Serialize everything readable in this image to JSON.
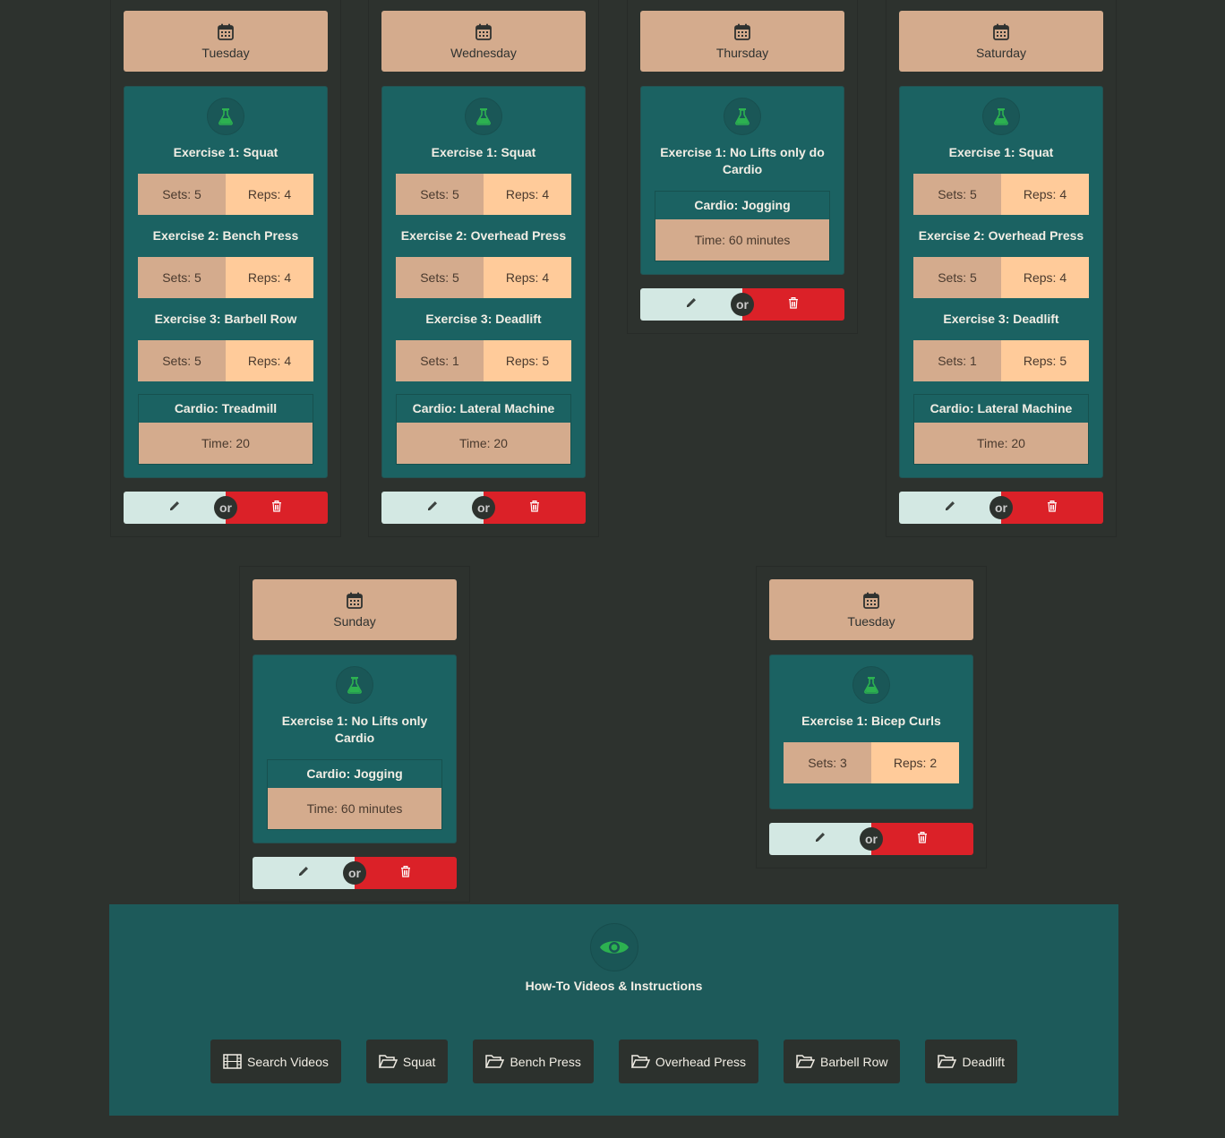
{
  "days": [
    {
      "day": "Tuesday",
      "exercises": [
        {
          "title": "Exercise 1: Squat",
          "sets": "Sets: 5",
          "reps": "Reps: 4"
        },
        {
          "title": "Exercise 2: Bench Press",
          "sets": "Sets: 5",
          "reps": "Reps: 4"
        },
        {
          "title": "Exercise 3: Barbell Row",
          "sets": "Sets: 5",
          "reps": "Reps: 4"
        }
      ],
      "cardio": {
        "title": "Cardio: Treadmill",
        "time": "Time: 20"
      }
    },
    {
      "day": "Wednesday",
      "exercises": [
        {
          "title": "Exercise 1: Squat",
          "sets": "Sets: 5",
          "reps": "Reps: 4"
        },
        {
          "title": "Exercise 2: Overhead Press",
          "sets": "Sets: 5",
          "reps": "Reps: 4"
        },
        {
          "title": "Exercise 3: Deadlift",
          "sets": "Sets: 1",
          "reps": "Reps: 5"
        }
      ],
      "cardio": {
        "title": "Cardio: Lateral Machine",
        "time": "Time: 20"
      }
    },
    {
      "day": "Thursday",
      "exercises": [
        {
          "title": "Exercise 1: No Lifts only do Cardio"
        }
      ],
      "cardio": {
        "title": "Cardio: Jogging",
        "time": "Time: 60 minutes"
      }
    },
    {
      "day": "Saturday",
      "exercises": [
        {
          "title": "Exercise 1: Squat",
          "sets": "Sets: 5",
          "reps": "Reps: 4"
        },
        {
          "title": "Exercise 2: Overhead Press",
          "sets": "Sets: 5",
          "reps": "Reps: 4"
        },
        {
          "title": "Exercise 3: Deadlift",
          "sets": "Sets: 1",
          "reps": "Reps: 5"
        }
      ],
      "cardio": {
        "title": "Cardio: Lateral Machine",
        "time": "Time: 20"
      }
    },
    {
      "day": "Sunday",
      "exercises": [
        {
          "title": "Exercise 1: No Lifts only Cardio"
        }
      ],
      "cardio": {
        "title": "Cardio: Jogging",
        "time": "Time: 60 minutes"
      }
    },
    {
      "day": "Tuesday",
      "exercises": [
        {
          "title": "Exercise 1: Bicep Curls",
          "sets": "Sets: 3",
          "reps": "Reps: 2"
        }
      ]
    }
  ],
  "or_label": "or",
  "howto": {
    "title": "How-To Videos & Instructions",
    "buttons": [
      {
        "label": "Search Videos",
        "icon": "film-icon"
      },
      {
        "label": "Squat",
        "icon": "folder-open-icon"
      },
      {
        "label": "Bench Press",
        "icon": "folder-open-icon"
      },
      {
        "label": "Overhead Press",
        "icon": "folder-open-icon"
      },
      {
        "label": "Barbell Row",
        "icon": "folder-open-icon"
      },
      {
        "label": "Deadlift",
        "icon": "folder-open-icon"
      }
    ]
  },
  "colors": {
    "background": "#2d322e",
    "header": "#d4ab8d",
    "workout": "#1b6262",
    "reps": "#ffcb9a",
    "edit": "#d3e8e3",
    "delete": "#db2128",
    "icon_green": "#2cb150"
  }
}
